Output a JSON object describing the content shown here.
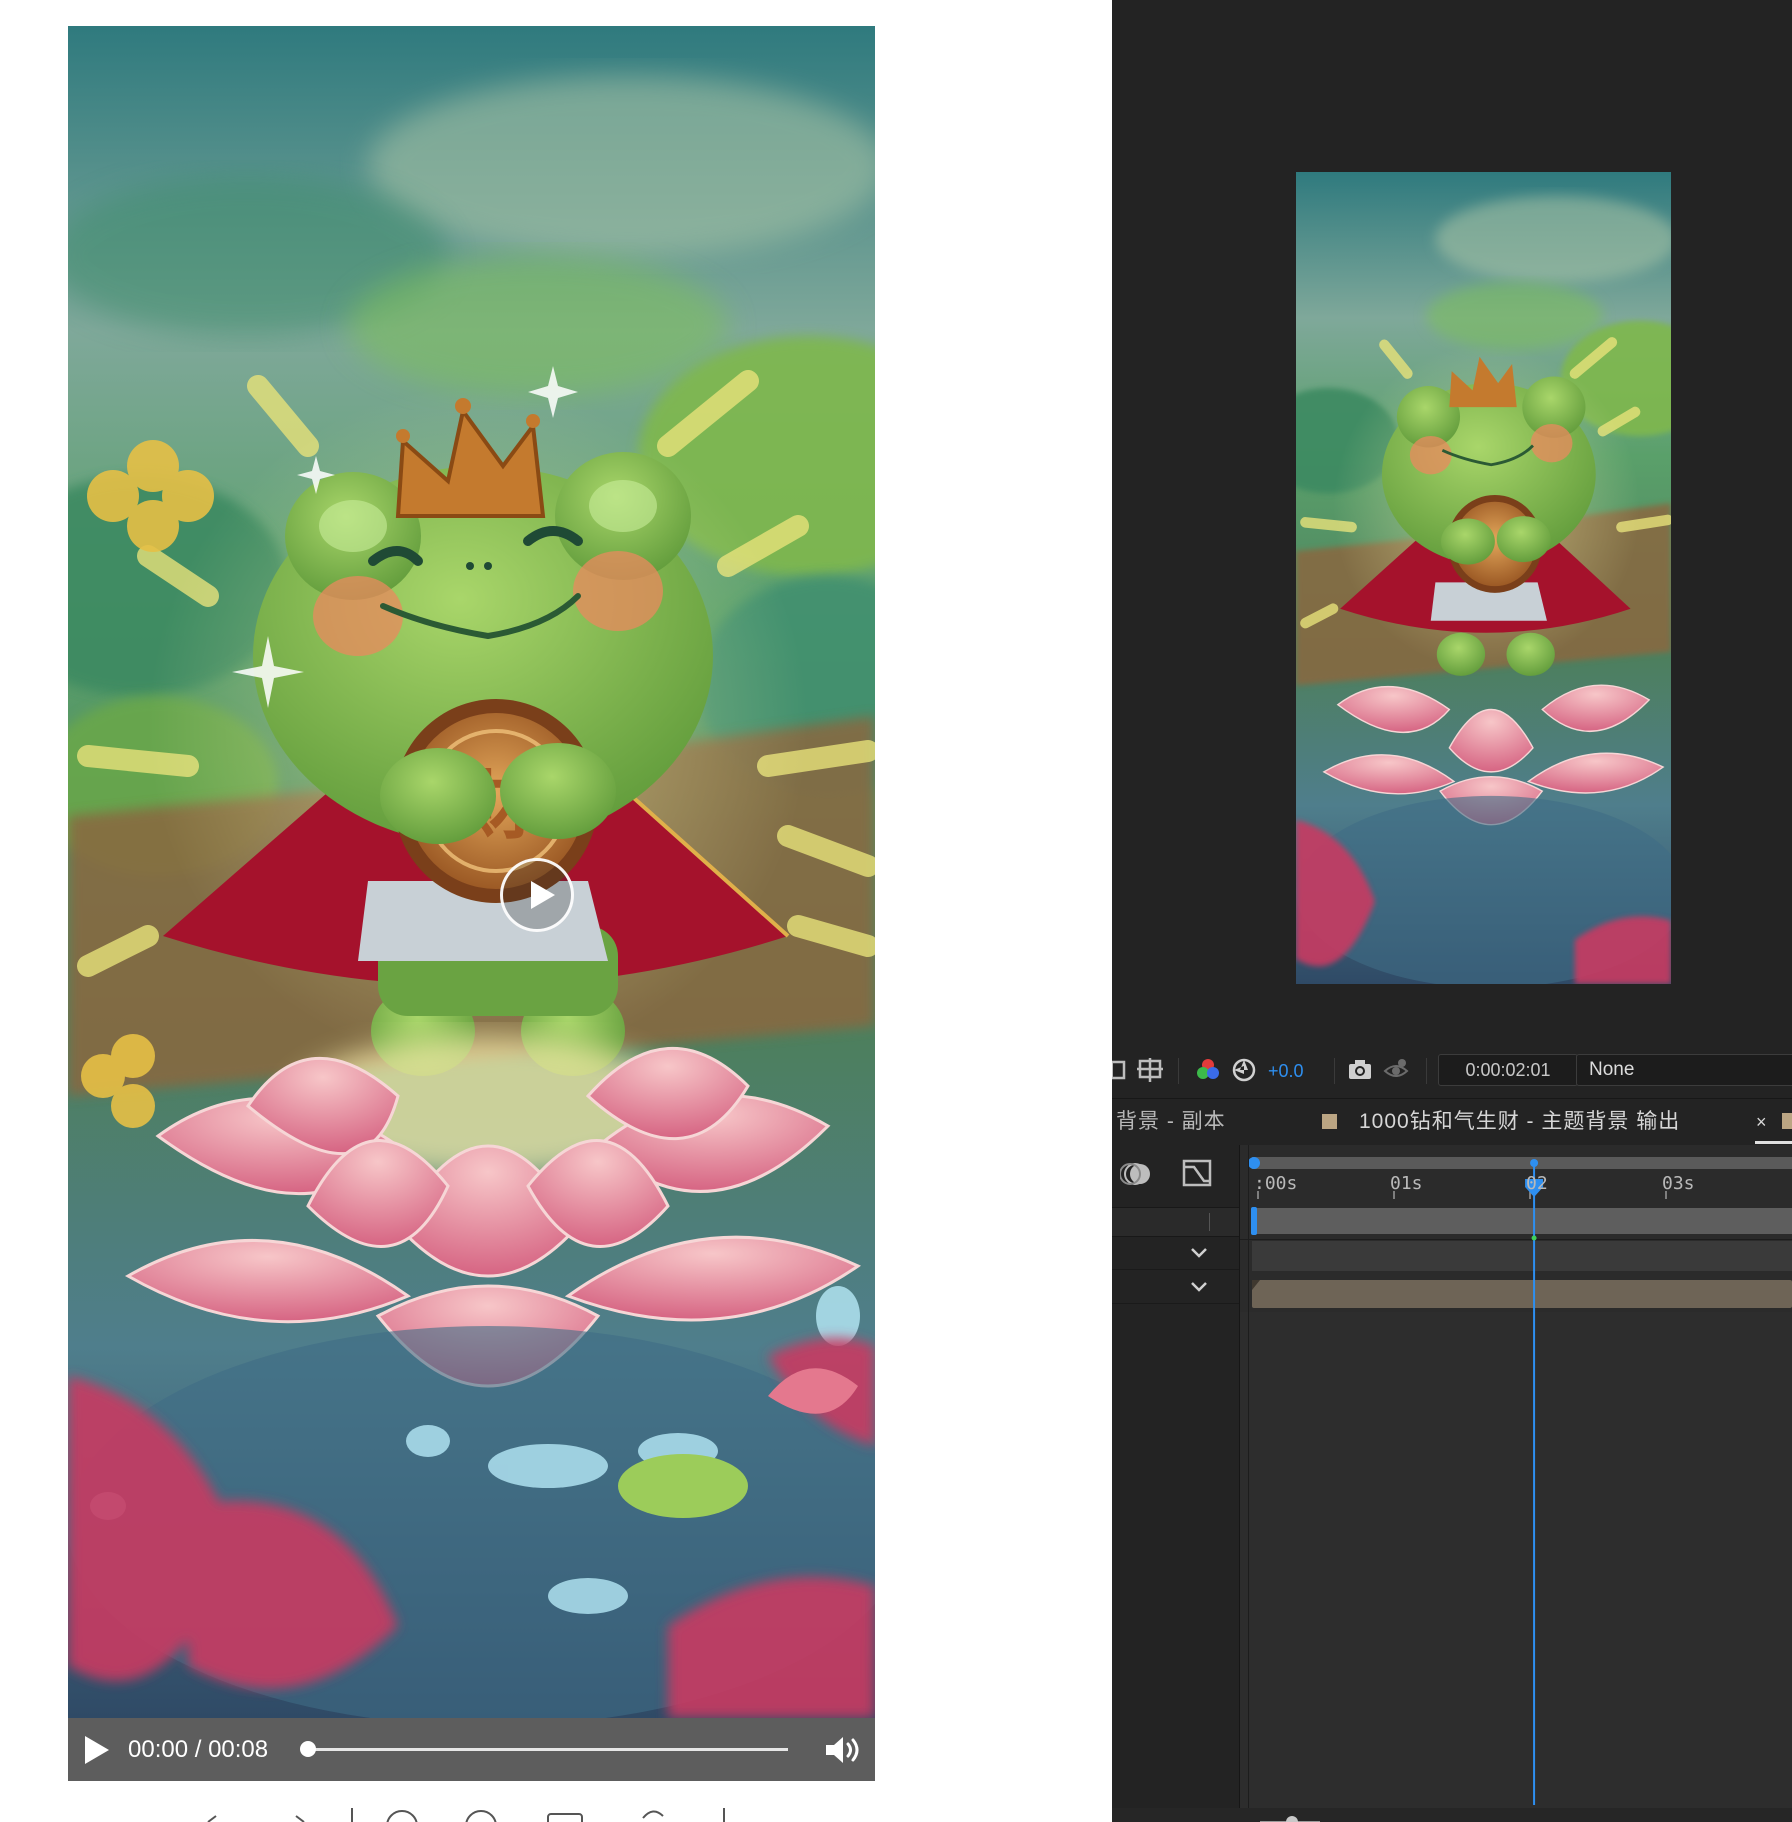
{
  "player": {
    "current_time": "00:00",
    "duration": "00:08",
    "time_display": "00:00 / 00:08",
    "progress_fraction": 0.0
  },
  "artwork": {
    "coin_character": "财"
  },
  "ae": {
    "exposure_value": "+0.0",
    "timecode": "0:00:02:01",
    "view_option": "None",
    "tabs": [
      {
        "label": "背景 - 副本",
        "active": false
      },
      {
        "label": "1000钻和气生财 - 主题背景 输出",
        "active": true
      }
    ],
    "tab_close_glyph": "×",
    "ruler_labels": [
      ":00s",
      "01s",
      "02",
      "03s"
    ],
    "playhead_seconds": 2.03,
    "accent_color": "#2e8ff0",
    "layer_bar_color": "#6e6456",
    "tab_swatch_color": "#bba583"
  }
}
